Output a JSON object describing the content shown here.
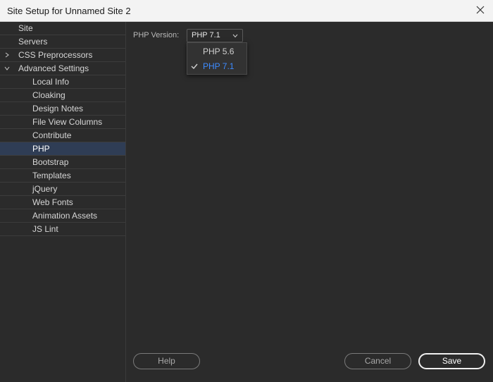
{
  "window": {
    "title": "Site Setup for Unnamed Site 2",
    "close_icon": "close-icon"
  },
  "sidebar": {
    "items": [
      {
        "label": "Site",
        "level": 0
      },
      {
        "label": "Servers",
        "level": 0
      },
      {
        "label": "CSS Preprocessors",
        "level": 0,
        "expander": "collapsed"
      },
      {
        "label": "Advanced Settings",
        "level": 0,
        "expander": "expanded"
      },
      {
        "label": "Local Info",
        "level": 1
      },
      {
        "label": "Cloaking",
        "level": 1
      },
      {
        "label": "Design Notes",
        "level": 1
      },
      {
        "label": "File View Columns",
        "level": 1
      },
      {
        "label": "Contribute",
        "level": 1
      },
      {
        "label": "PHP",
        "level": 1,
        "selected": true
      },
      {
        "label": "Bootstrap",
        "level": 1
      },
      {
        "label": "Templates",
        "level": 1
      },
      {
        "label": "jQuery",
        "level": 1
      },
      {
        "label": "Web Fonts",
        "level": 1
      },
      {
        "label": "Animation Assets",
        "level": 1
      },
      {
        "label": "JS Lint",
        "level": 1
      }
    ]
  },
  "php": {
    "label": "PHP Version:",
    "selected": "PHP 7.1",
    "options": [
      "PHP 5.6",
      "PHP 7.1"
    ]
  },
  "buttons": {
    "help": "Help",
    "cancel": "Cancel",
    "save": "Save"
  },
  "colors": {
    "accent": "#3d8bff",
    "selection": "#2f3d55",
    "background": "#2b2b2b"
  }
}
